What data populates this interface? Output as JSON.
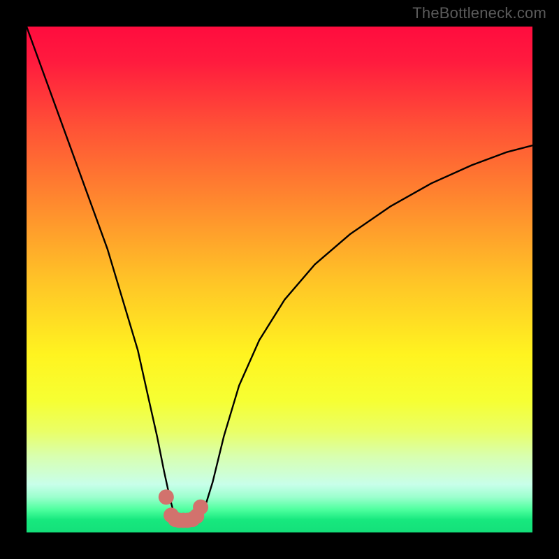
{
  "watermark": "TheBottleneck.com",
  "chart_data": {
    "type": "line",
    "title": "",
    "xlabel": "",
    "ylabel": "",
    "xlim": [
      0,
      100
    ],
    "ylim": [
      0,
      100
    ],
    "gradient_stops": [
      {
        "offset": 0,
        "color": "#ff0c3e"
      },
      {
        "offset": 0.07,
        "color": "#ff1b3e"
      },
      {
        "offset": 0.2,
        "color": "#ff5236"
      },
      {
        "offset": 0.35,
        "color": "#ff8a2e"
      },
      {
        "offset": 0.5,
        "color": "#ffc327"
      },
      {
        "offset": 0.65,
        "color": "#fff420"
      },
      {
        "offset": 0.74,
        "color": "#f6ff33"
      },
      {
        "offset": 0.8,
        "color": "#eaff66"
      },
      {
        "offset": 0.85,
        "color": "#d8ffb0"
      },
      {
        "offset": 0.905,
        "color": "#c8ffea"
      },
      {
        "offset": 0.93,
        "color": "#9cffce"
      },
      {
        "offset": 0.955,
        "color": "#4dff9e"
      },
      {
        "offset": 0.975,
        "color": "#17e87e"
      },
      {
        "offset": 1.0,
        "color": "#14e07a"
      }
    ],
    "series": [
      {
        "name": "bottleneck-curve",
        "color": "#000000",
        "width": 2.4,
        "x": [
          0,
          4,
          8,
          12,
          16,
          19,
          22,
          24,
          25.8,
          27.2,
          28.4,
          29.4,
          30.2,
          31.0,
          33.0,
          34.0,
          35.2,
          36.8,
          39,
          42,
          46,
          51,
          57,
          64,
          72,
          80,
          88,
          95,
          100
        ],
        "y": [
          100,
          89,
          78,
          67,
          56,
          46,
          36,
          27,
          19,
          12,
          6.5,
          2.8,
          2.4,
          2.4,
          2.4,
          2.6,
          4.8,
          10,
          19,
          29,
          38,
          46,
          53,
          59,
          64.5,
          69,
          72.6,
          75.2,
          76.5
        ]
      },
      {
        "name": "highlight-dots",
        "color": "#d2726d",
        "type": "scatter",
        "marker_size": 11,
        "x": [
          27.6,
          28.6,
          29.4,
          30.2,
          31.0,
          31.8,
          32.8,
          33.6,
          34.4
        ],
        "y": [
          7.0,
          3.4,
          2.6,
          2.4,
          2.4,
          2.4,
          2.6,
          3.2,
          5.0
        ]
      }
    ]
  }
}
